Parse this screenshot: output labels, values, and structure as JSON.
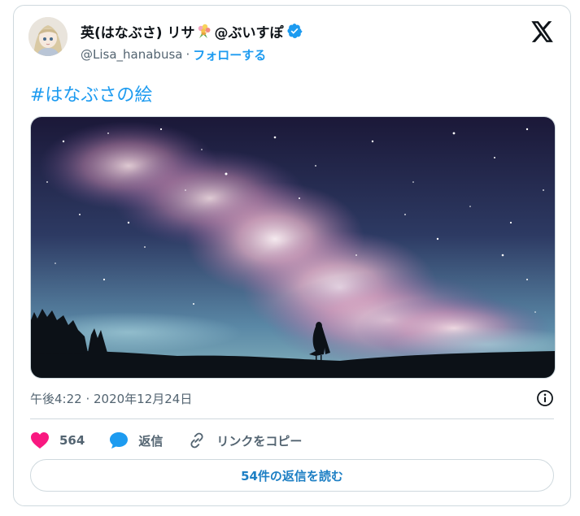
{
  "author": {
    "display_name": "英(はなぶさ) リサ",
    "display_name_suffix": "@ぶいすぽ",
    "handle": "@Lisa_hanabusa",
    "separator": "·",
    "follow_label": "フォローする",
    "verified": true
  },
  "post": {
    "hashtag": "#はなぶさの絵",
    "timestamp": "午後4:22 · 2020年12月24日"
  },
  "actions": {
    "like_count": "564",
    "reply_label": "返信",
    "copy_link_label": "リンクをコピー"
  },
  "replies_button_label": "54件の返信を読む",
  "colors": {
    "accent": "#1d9bf0",
    "like": "#f91880",
    "muted": "#536471",
    "border": "#cfd9de"
  },
  "icons": {
    "brand": "x-logo-icon",
    "verified": "verified-badge-icon",
    "like": "heart-icon",
    "reply": "speech-bubble-icon",
    "copy": "link-icon",
    "info": "info-icon"
  }
}
